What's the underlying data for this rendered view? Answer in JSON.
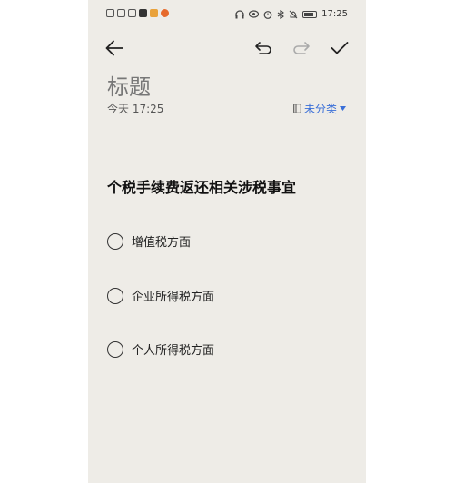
{
  "status_bar": {
    "left_icons": [
      "hd-icon",
      "signal-icon",
      "sim-icon",
      "penguin-icon",
      "photo-app-icon",
      "notification-icon"
    ],
    "right_icons": [
      "headphones-icon",
      "eye-icon",
      "alarm-icon",
      "bluetooth-icon",
      "mute-icon",
      "battery-icon"
    ],
    "battery": "99",
    "time": "17:25"
  },
  "toolbar": {
    "back_icon": "arrow-left-icon",
    "undo_icon": "undo-icon",
    "redo_icon": "redo-icon",
    "confirm_icon": "check-icon"
  },
  "note": {
    "title": "标题",
    "date": "今天 17:25",
    "category": "未分类",
    "heading": "个税手续费返还相关涉税事宜",
    "items": [
      {
        "label": "增值税方面",
        "checked": false
      },
      {
        "label": "企业所得税方面",
        "checked": false
      },
      {
        "label": "个人所得税方面",
        "checked": false
      }
    ]
  },
  "colors": {
    "background": "#eeece7",
    "accent": "#3a6fd8",
    "text": "#111111"
  }
}
